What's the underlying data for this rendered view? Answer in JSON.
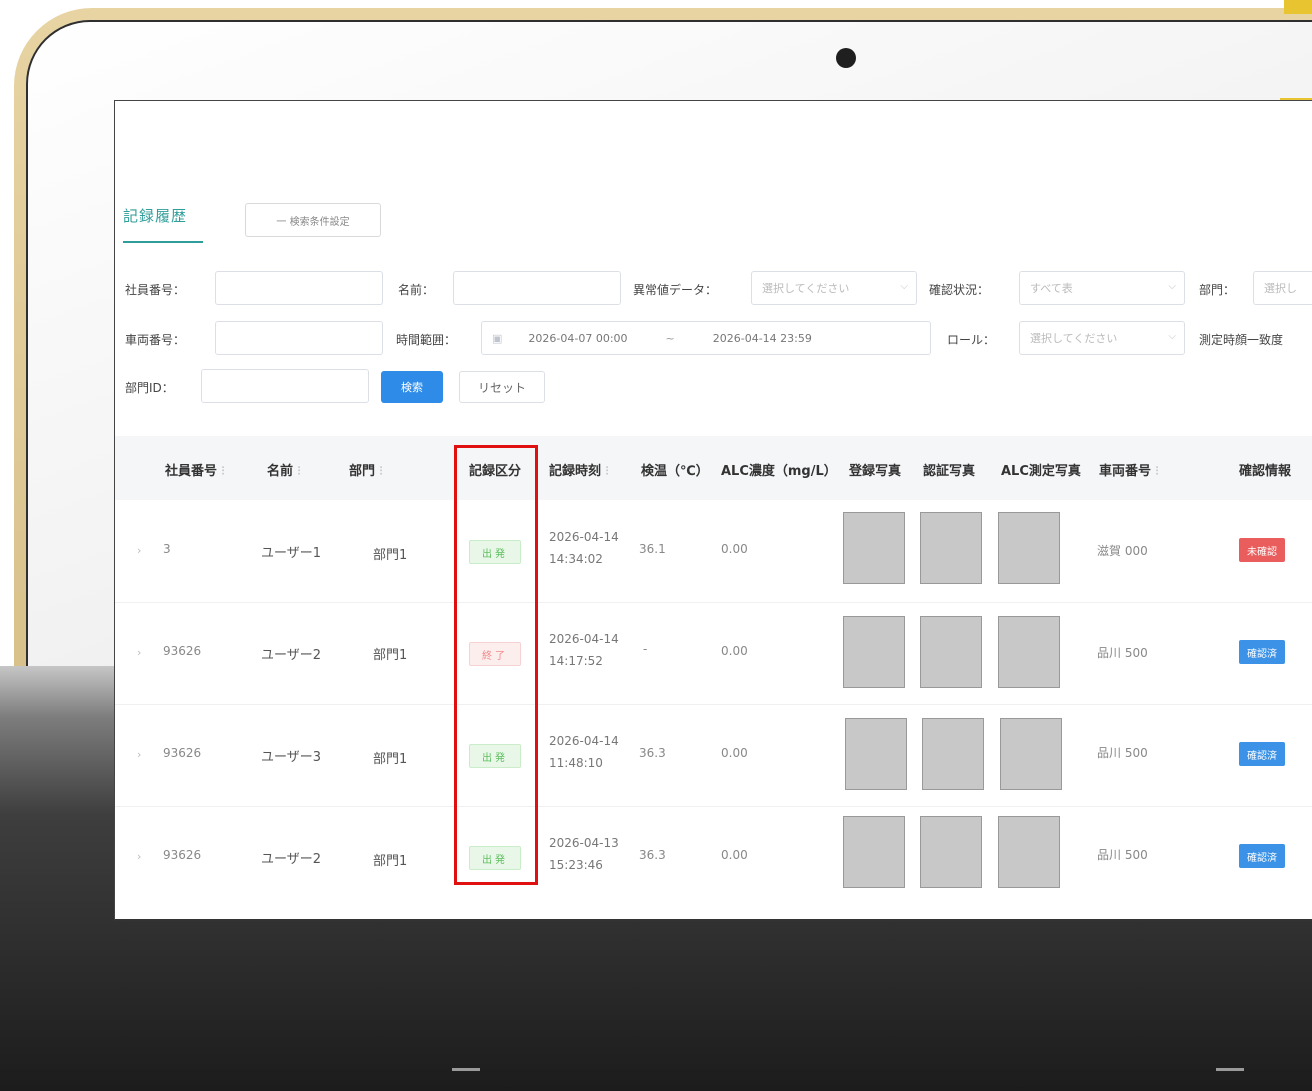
{
  "tabs": {
    "active": "記録履歴",
    "condition_button": "一 検索条件設定"
  },
  "filters": {
    "employee_no_label": "社員番号：",
    "name_label": "名前：",
    "abnormal_label": "異常値データ：",
    "abnormal_placeholder": "選択してください",
    "confirm_status_label": "確認状況：",
    "confirm_status_value": "すべて表",
    "dept_label": "部門：",
    "dept_placeholder": "選択し",
    "vehicle_no_label": "車両番号：",
    "time_range_label": "時間範囲：",
    "time_start": "2026-04-07 00:00",
    "time_sep": "~",
    "time_end": "2026-04-14 23:59",
    "role_label": "ロール：",
    "role_placeholder": "選択してください",
    "match_label": "測定時顔一致度",
    "dept_id_label": "部門ID：",
    "search_button": "検索",
    "reset_button": "リセット"
  },
  "table": {
    "headers": {
      "employee_no": "社員番号",
      "name": "名前",
      "dept": "部門",
      "record_type": "記録区分",
      "record_time": "記録時刻",
      "temperature": "検温（℃）",
      "alc": "ALC濃度（mg/L）",
      "reg_photo": "登録写真",
      "auth_photo": "認証写真",
      "alc_photo": "ALC測定写真",
      "vehicle_no": "車両番号",
      "confirm_info": "確認情報"
    },
    "rows": [
      {
        "employee_no": "3",
        "name": "ユーザー1",
        "dept": "部門1",
        "record_type": "出発",
        "date": "2026-04-14",
        "time": "14:34:02",
        "temp": "36.1",
        "alc": "0.00",
        "vehicle": "滋賀 000",
        "status": "未確認"
      },
      {
        "employee_no": "93626",
        "name": "ユーザー2",
        "dept": "部門1",
        "record_type": "終了",
        "date": "2026-04-14",
        "time": "14:17:52",
        "temp": "-",
        "alc": "0.00",
        "vehicle": "品川 500",
        "status": "確認済"
      },
      {
        "employee_no": "93626",
        "name": "ユーザー3",
        "dept": "部門1",
        "record_type": "出発",
        "date": "2026-04-14",
        "time": "11:48:10",
        "temp": "36.3",
        "alc": "0.00",
        "vehicle": "品川 500",
        "status": "確認済"
      },
      {
        "employee_no": "93626",
        "name": "ユーザー2",
        "dept": "部門1",
        "record_type": "出発",
        "date": "2026-04-13",
        "time": "15:23:46",
        "temp": "36.3",
        "alc": "0.00",
        "vehicle": "品川 500",
        "status": "確認済"
      }
    ]
  },
  "colors": {
    "accent": "#2f9e9a",
    "primary": "#2f8be8",
    "highlight": "#e01010",
    "unconfirmed": "#ea5d5d"
  }
}
